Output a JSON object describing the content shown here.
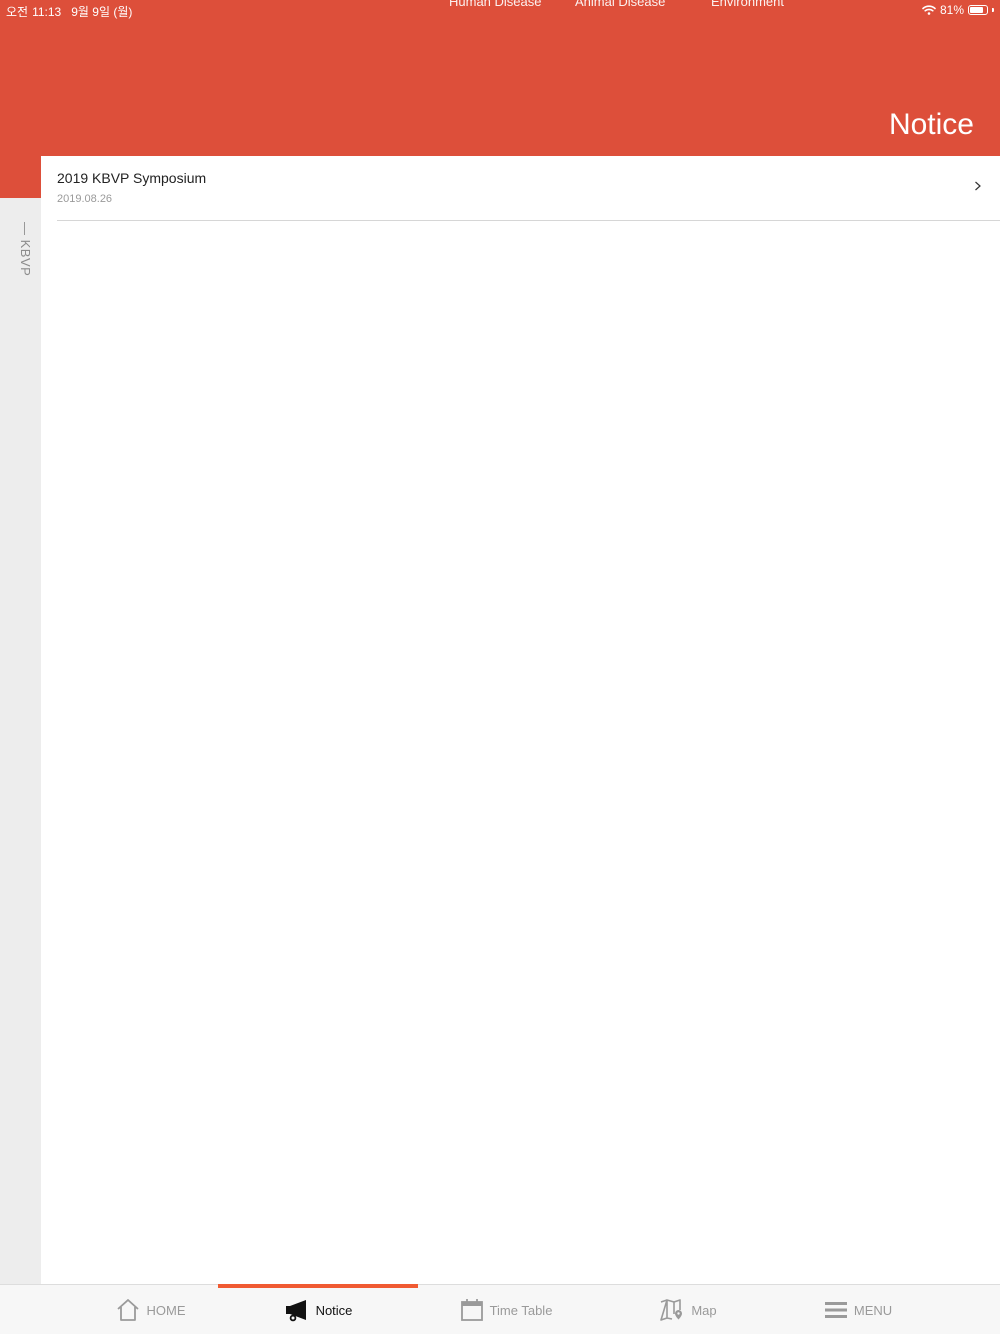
{
  "status_bar": {
    "ampm": "오전",
    "time": "11:13",
    "date": "9월 9일 (월)",
    "battery": "81%",
    "wifi_icon": "wifi-icon",
    "battery_icon": "battery-icon"
  },
  "top_nav": {
    "items": [
      {
        "label": "Human Disease"
      },
      {
        "label": "Animal Disease"
      },
      {
        "label": "Environment"
      }
    ]
  },
  "header": {
    "title": "Notice"
  },
  "side_rail": {
    "label": "— KBVP"
  },
  "notices": [
    {
      "title": "2019 KBVP Symposium",
      "date": "2019.08.26",
      "chevron": ">"
    }
  ],
  "tab_bar": {
    "items": [
      {
        "label": "HOME",
        "icon": "home-icon",
        "active": false
      },
      {
        "label": "Notice",
        "icon": "megaphone-icon",
        "active": true
      },
      {
        "label": "Time Table",
        "icon": "calendar-icon",
        "active": false
      },
      {
        "label": "Map",
        "icon": "map-icon",
        "active": false
      },
      {
        "label": "MENU",
        "icon": "menu-icon",
        "active": false
      }
    ],
    "active_color": "#f05a32"
  },
  "colors": {
    "header": "#dd4f3a",
    "side_rail": "#ededed",
    "active_tab_indicator": "#f05a32"
  }
}
